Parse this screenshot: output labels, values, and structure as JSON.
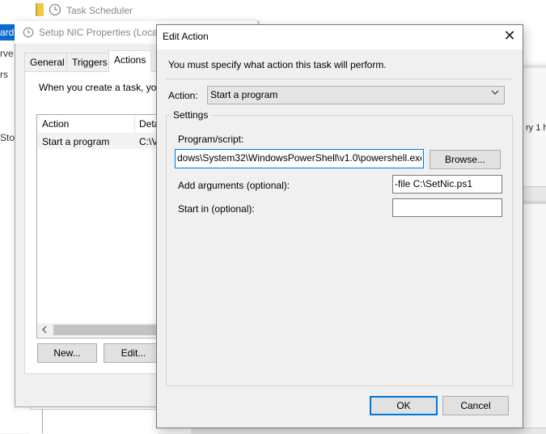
{
  "task_scheduler": {
    "title": "Task Scheduler",
    "left_fragments": [
      "ard",
      "rve",
      "rs",
      "Sto"
    ],
    "right_fragment": "ry 1 h"
  },
  "props_window": {
    "title": "Setup NIC Properties (Local",
    "tabs": [
      "General",
      "Triggers",
      "Actions"
    ],
    "description": "When you create a task, you",
    "columns": [
      "Action",
      "Deta"
    ],
    "rows": [
      {
        "action": "Start a program",
        "detail": "C:\\V"
      }
    ],
    "buttons": {
      "new": "New...",
      "edit": "Edit..."
    }
  },
  "edit_action": {
    "title": "Edit Action",
    "close_glyph": "✕",
    "instruction": "You must specify what action this task will perform.",
    "action_label": "Action:",
    "action_value": "Start a program",
    "settings_label": "Settings",
    "program_label": "Program/script:",
    "program_value": "dows\\System32\\WindowsPowerShell\\v1.0\\powershell.exe",
    "browse_label": "Browse...",
    "args_label": "Add arguments (optional):",
    "args_value": "-file C:\\SetNic.ps1",
    "startin_label": "Start in (optional):",
    "startin_value": "",
    "ok_label": "OK",
    "cancel_label": "Cancel"
  },
  "icons": {
    "clock": "clock-icon",
    "close": "close-icon",
    "chevron": "chevron-down-icon",
    "scroll_left": "scroll-left-icon",
    "folder": "folder-icon"
  },
  "colors": {
    "accent": "#0078d7",
    "selection": "#0a6cce",
    "button_face": "#e1e1e1",
    "window_bg": "#f0f0f0"
  }
}
